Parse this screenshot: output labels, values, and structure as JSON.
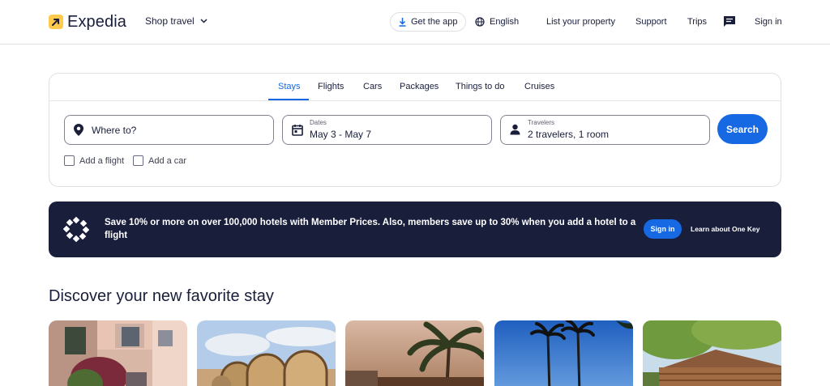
{
  "header": {
    "brand": "Expedia",
    "shop_travel": "Shop travel",
    "get_app": "Get the app",
    "language": "English",
    "list_property": "List your property",
    "support": "Support",
    "trips": "Trips",
    "sign_in": "Sign in"
  },
  "search": {
    "tabs": [
      "Stays",
      "Flights",
      "Cars",
      "Packages",
      "Things to do",
      "Cruises"
    ],
    "active_tab": "Stays",
    "destination_placeholder": "Where to?",
    "dates_label": "Dates",
    "dates_value": "May 3 - May 7",
    "travelers_label": "Travelers",
    "travelers_value": "2 travelers, 1 room",
    "search_button": "Search",
    "add_flight": "Add a flight",
    "add_car": "Add a car"
  },
  "banner": {
    "text": "Save 10% or more on over 100,000 hotels with Member Prices. Also, members save up to 30% when you add a hotel to a flight",
    "sign_in": "Sign in",
    "learn": "Learn about One Key"
  },
  "discover": {
    "title": "Discover your new favorite stay"
  },
  "colors": {
    "brand_blue": "#1668e3",
    "navy": "#191e3b",
    "logo_yellow": "#ffc94c"
  }
}
